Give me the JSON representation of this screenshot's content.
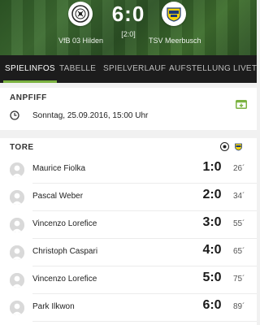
{
  "match": {
    "home_team": "VfB 03 Hilden",
    "away_team": "TSV Meerbusch",
    "score": "6:0",
    "halftime": "[2:0]"
  },
  "tabs": [
    "SPIELINFOS",
    "TABELLE",
    "SPIELVERLAUF",
    "AUFSTELLUNG",
    "LIVETI"
  ],
  "anpfiff": {
    "title": "ANPFIFF",
    "datetime": "Sonntag, 25.09.2016, 15:00 Uhr"
  },
  "tore": {
    "title": "TORE",
    "goals": [
      {
        "player": "Maurice Fiolka",
        "score": "1:0",
        "minute": "26´"
      },
      {
        "player": "Pascal Weber",
        "score": "2:0",
        "minute": "34´"
      },
      {
        "player": "Vincenzo Lorefice",
        "score": "3:0",
        "minute": "55´"
      },
      {
        "player": "Christoph Caspari",
        "score": "4:0",
        "minute": "65´"
      },
      {
        "player": "Vincenzo Lorefice",
        "score": "5:0",
        "minute": "75´"
      },
      {
        "player": "Park Ilkwon",
        "score": "6:0",
        "minute": "89´"
      }
    ]
  },
  "colors": {
    "accent": "#7bb241",
    "tab_bar": "#1c1c1c",
    "header_green": "#3a6630"
  }
}
